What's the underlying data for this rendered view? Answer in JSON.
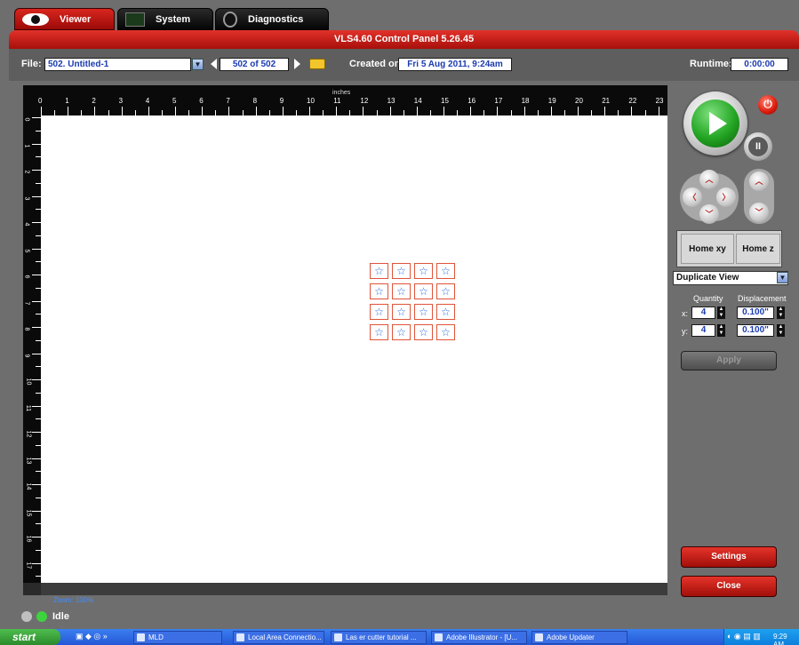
{
  "tabs": [
    {
      "label": "Viewer",
      "icon": "eye-icon",
      "active": true
    },
    {
      "label": "System",
      "icon": "monitor-icon",
      "active": false
    },
    {
      "label": "Diagnostics",
      "icon": "stethoscope-icon",
      "active": false
    }
  ],
  "window": {
    "title": "VLS4.60  Control Panel  5.26.45"
  },
  "toolbar": {
    "file_label": "File:",
    "file_value": "502. Untitled-1",
    "page_counter": "502 of 502",
    "created_label": "Created on:",
    "created_value": "Fri 5 Aug 2011,  9:24am",
    "runtime_label": "Runtime:",
    "runtime_value": "0:00:00"
  },
  "ruler": {
    "units": "inches",
    "x_ticks": [
      "0",
      "1",
      "2",
      "3",
      "4",
      "5",
      "6",
      "7",
      "8",
      "9",
      "10",
      "11",
      "12",
      "13",
      "14",
      "15",
      "16",
      "17",
      "18",
      "19",
      "20",
      "21",
      "22",
      "23"
    ],
    "y_ticks": [
      "0",
      "1",
      "2",
      "3",
      "4",
      "5",
      "6",
      "7",
      "8",
      "9",
      "10",
      "11",
      "12",
      "13",
      "14",
      "15",
      "16",
      "17"
    ]
  },
  "canvas": {
    "zoom": "Zoom: 100%",
    "grid": {
      "rows": 4,
      "cols": 4,
      "glyph": "☆"
    }
  },
  "controls": {
    "play": "play-icon",
    "pause": "pause-icon",
    "power": "power-icon",
    "arrows": [
      "up",
      "down",
      "left",
      "right",
      "z-up",
      "z-down"
    ],
    "home_xy": "Home xy",
    "home_z": "Home z"
  },
  "duplicate": {
    "mode": "Duplicate View",
    "quantity_label": "Quantity",
    "displacement_label": "Displacement",
    "x_label": "x:",
    "y_label": "y:",
    "x_quantity": "4",
    "y_quantity": "4",
    "x_displacement": "0.100\"",
    "y_displacement": "0.100\"",
    "apply": "Apply"
  },
  "buttons": {
    "settings": "Settings",
    "close": "Close"
  },
  "status": {
    "text": "Idle",
    "led_off_color": "#bfbfbf",
    "led_on_color": "#3fd23f"
  },
  "taskbar": {
    "start": "start",
    "quick": "MLD",
    "tasks": [
      "Local Area Connectio...",
      "Las er cutter tutorial ...",
      "Adobe Illustrator - [U...",
      "Adobe Updater"
    ],
    "clock": "9:29 AM"
  }
}
